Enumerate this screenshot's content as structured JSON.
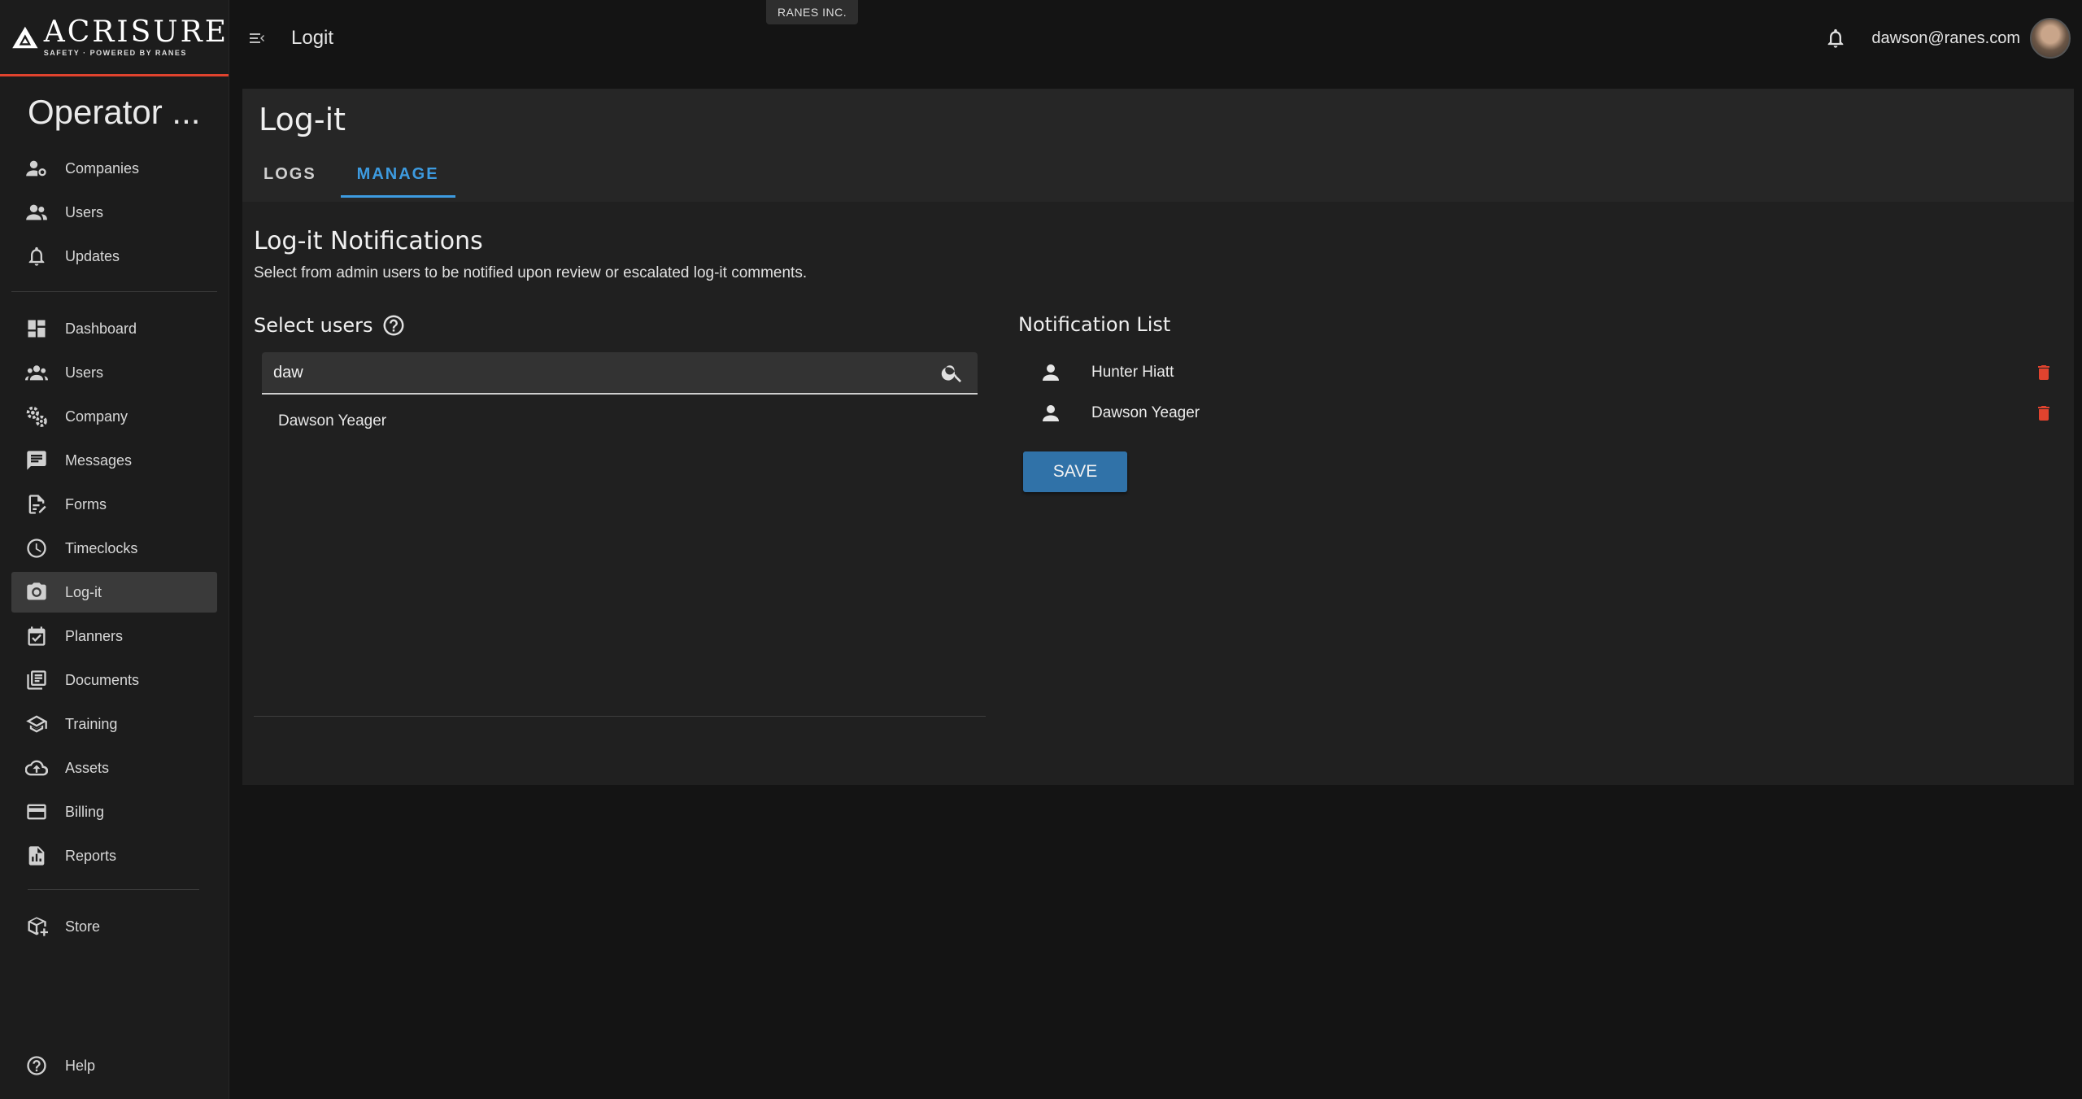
{
  "brand": {
    "name": "ACRISURE",
    "tagline": "SAFETY · POWERED BY RANES"
  },
  "sidebar": {
    "title": "Operator ...",
    "group1": [
      {
        "label": "Companies",
        "icon": "companies-icon"
      },
      {
        "label": "Users",
        "icon": "users-icon"
      },
      {
        "label": "Updates",
        "icon": "bell-icon"
      }
    ],
    "group2": [
      {
        "label": "Dashboard",
        "icon": "dashboard-icon"
      },
      {
        "label": "Users",
        "icon": "users-icon"
      },
      {
        "label": "Company",
        "icon": "gears-icon"
      },
      {
        "label": "Messages",
        "icon": "message-icon"
      },
      {
        "label": "Forms",
        "icon": "forms-icon"
      },
      {
        "label": "Timeclocks",
        "icon": "clock-icon"
      },
      {
        "label": "Log-it",
        "icon": "camera-icon",
        "active": true
      },
      {
        "label": "Planners",
        "icon": "calendar-check-icon"
      },
      {
        "label": "Documents",
        "icon": "documents-icon"
      },
      {
        "label": "Training",
        "icon": "graduation-cap-icon"
      },
      {
        "label": "Assets",
        "icon": "cloud-upload-icon"
      },
      {
        "label": "Billing",
        "icon": "credit-card-icon"
      },
      {
        "label": "Reports",
        "icon": "report-icon"
      }
    ],
    "store": {
      "label": "Store",
      "icon": "store-box-icon"
    },
    "help": {
      "label": "Help",
      "icon": "help-circle-icon"
    }
  },
  "header": {
    "title": "Logit",
    "company": "RANES INC.",
    "user_email": "dawson@ranes.com"
  },
  "page": {
    "title": "Log-it",
    "tabs": [
      {
        "label": "LOGS"
      },
      {
        "label": "MANAGE",
        "active": true
      }
    ],
    "section_title": "Log-it Notifications",
    "section_desc": "Select from admin users to be notified upon review or escalated log-it comments.",
    "select_users": {
      "heading": "Select users",
      "search_value": "daw",
      "results": [
        "Dawson Yeager"
      ]
    },
    "notification_list": {
      "heading": "Notification List",
      "users": [
        "Hunter Hiatt",
        "Dawson Yeager"
      ]
    },
    "save_label": "SAVE"
  },
  "colors": {
    "accent": "#3d9be0",
    "brand_red": "#e0432e",
    "save_button": "#3072a8"
  }
}
